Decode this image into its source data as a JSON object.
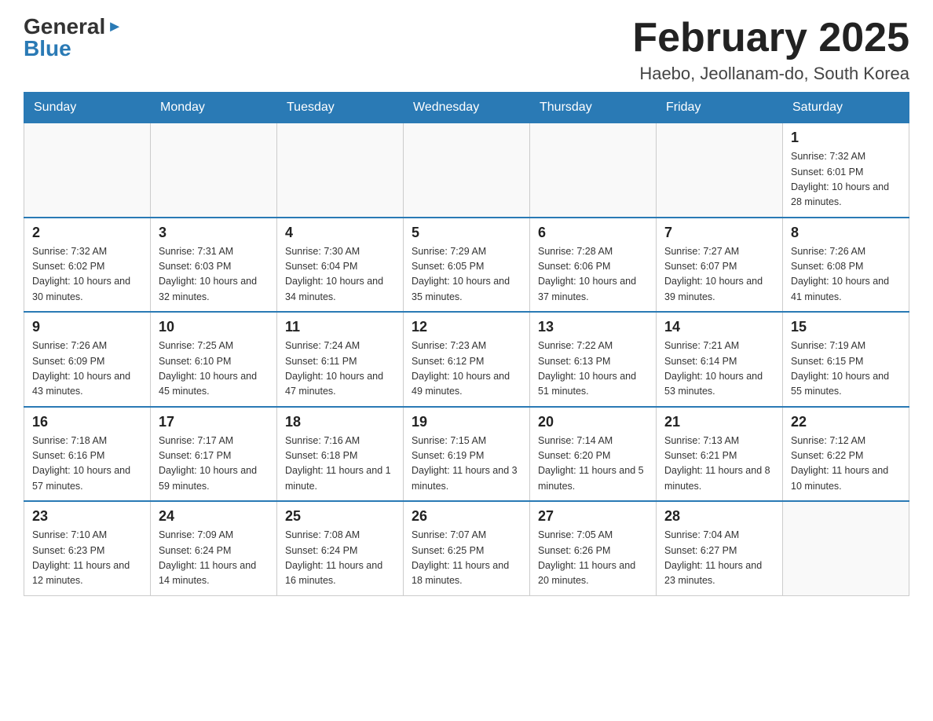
{
  "logo": {
    "general": "General",
    "blue": "Blue"
  },
  "header": {
    "title": "February 2025",
    "location": "Haebo, Jeollanam-do, South Korea"
  },
  "days_of_week": [
    "Sunday",
    "Monday",
    "Tuesday",
    "Wednesday",
    "Thursday",
    "Friday",
    "Saturday"
  ],
  "weeks": [
    {
      "days": [
        {
          "num": "",
          "info": ""
        },
        {
          "num": "",
          "info": ""
        },
        {
          "num": "",
          "info": ""
        },
        {
          "num": "",
          "info": ""
        },
        {
          "num": "",
          "info": ""
        },
        {
          "num": "",
          "info": ""
        },
        {
          "num": "1",
          "info": "Sunrise: 7:32 AM\nSunset: 6:01 PM\nDaylight: 10 hours and 28 minutes."
        }
      ]
    },
    {
      "days": [
        {
          "num": "2",
          "info": "Sunrise: 7:32 AM\nSunset: 6:02 PM\nDaylight: 10 hours and 30 minutes."
        },
        {
          "num": "3",
          "info": "Sunrise: 7:31 AM\nSunset: 6:03 PM\nDaylight: 10 hours and 32 minutes."
        },
        {
          "num": "4",
          "info": "Sunrise: 7:30 AM\nSunset: 6:04 PM\nDaylight: 10 hours and 34 minutes."
        },
        {
          "num": "5",
          "info": "Sunrise: 7:29 AM\nSunset: 6:05 PM\nDaylight: 10 hours and 35 minutes."
        },
        {
          "num": "6",
          "info": "Sunrise: 7:28 AM\nSunset: 6:06 PM\nDaylight: 10 hours and 37 minutes."
        },
        {
          "num": "7",
          "info": "Sunrise: 7:27 AM\nSunset: 6:07 PM\nDaylight: 10 hours and 39 minutes."
        },
        {
          "num": "8",
          "info": "Sunrise: 7:26 AM\nSunset: 6:08 PM\nDaylight: 10 hours and 41 minutes."
        }
      ]
    },
    {
      "days": [
        {
          "num": "9",
          "info": "Sunrise: 7:26 AM\nSunset: 6:09 PM\nDaylight: 10 hours and 43 minutes."
        },
        {
          "num": "10",
          "info": "Sunrise: 7:25 AM\nSunset: 6:10 PM\nDaylight: 10 hours and 45 minutes."
        },
        {
          "num": "11",
          "info": "Sunrise: 7:24 AM\nSunset: 6:11 PM\nDaylight: 10 hours and 47 minutes."
        },
        {
          "num": "12",
          "info": "Sunrise: 7:23 AM\nSunset: 6:12 PM\nDaylight: 10 hours and 49 minutes."
        },
        {
          "num": "13",
          "info": "Sunrise: 7:22 AM\nSunset: 6:13 PM\nDaylight: 10 hours and 51 minutes."
        },
        {
          "num": "14",
          "info": "Sunrise: 7:21 AM\nSunset: 6:14 PM\nDaylight: 10 hours and 53 minutes."
        },
        {
          "num": "15",
          "info": "Sunrise: 7:19 AM\nSunset: 6:15 PM\nDaylight: 10 hours and 55 minutes."
        }
      ]
    },
    {
      "days": [
        {
          "num": "16",
          "info": "Sunrise: 7:18 AM\nSunset: 6:16 PM\nDaylight: 10 hours and 57 minutes."
        },
        {
          "num": "17",
          "info": "Sunrise: 7:17 AM\nSunset: 6:17 PM\nDaylight: 10 hours and 59 minutes."
        },
        {
          "num": "18",
          "info": "Sunrise: 7:16 AM\nSunset: 6:18 PM\nDaylight: 11 hours and 1 minute."
        },
        {
          "num": "19",
          "info": "Sunrise: 7:15 AM\nSunset: 6:19 PM\nDaylight: 11 hours and 3 minutes."
        },
        {
          "num": "20",
          "info": "Sunrise: 7:14 AM\nSunset: 6:20 PM\nDaylight: 11 hours and 5 minutes."
        },
        {
          "num": "21",
          "info": "Sunrise: 7:13 AM\nSunset: 6:21 PM\nDaylight: 11 hours and 8 minutes."
        },
        {
          "num": "22",
          "info": "Sunrise: 7:12 AM\nSunset: 6:22 PM\nDaylight: 11 hours and 10 minutes."
        }
      ]
    },
    {
      "days": [
        {
          "num": "23",
          "info": "Sunrise: 7:10 AM\nSunset: 6:23 PM\nDaylight: 11 hours and 12 minutes."
        },
        {
          "num": "24",
          "info": "Sunrise: 7:09 AM\nSunset: 6:24 PM\nDaylight: 11 hours and 14 minutes."
        },
        {
          "num": "25",
          "info": "Sunrise: 7:08 AM\nSunset: 6:24 PM\nDaylight: 11 hours and 16 minutes."
        },
        {
          "num": "26",
          "info": "Sunrise: 7:07 AM\nSunset: 6:25 PM\nDaylight: 11 hours and 18 minutes."
        },
        {
          "num": "27",
          "info": "Sunrise: 7:05 AM\nSunset: 6:26 PM\nDaylight: 11 hours and 20 minutes."
        },
        {
          "num": "28",
          "info": "Sunrise: 7:04 AM\nSunset: 6:27 PM\nDaylight: 11 hours and 23 minutes."
        },
        {
          "num": "",
          "info": ""
        }
      ]
    }
  ],
  "accent_color": "#2a7ab5"
}
